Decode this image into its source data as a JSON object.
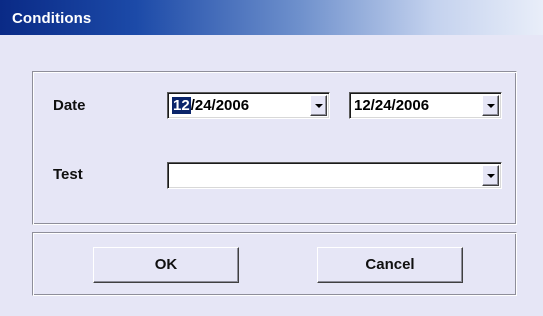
{
  "window": {
    "title": "Conditions"
  },
  "criteria": {
    "date_label": "Date",
    "date_from": {
      "selected_part": "12",
      "rest": "/24/2006"
    },
    "date_to": "12/24/2006",
    "test_label": "Test",
    "test_value": ""
  },
  "buttons": {
    "ok": "OK",
    "cancel": "Cancel"
  },
  "colors": {
    "title_gradient_start": "#0a2a86",
    "title_gradient_end": "#e9eef9",
    "dialog_background": "#e6e6f6",
    "selection_highlight": "#0a246a"
  },
  "icons": {
    "dropdown": "chevron-down-icon"
  }
}
